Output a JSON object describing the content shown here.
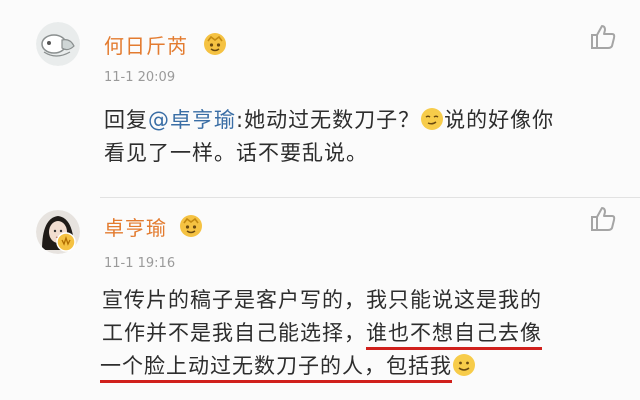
{
  "comments": [
    {
      "username": "何日斤芮",
      "time": "11-1 20:09",
      "text_reply_prefix": "回复",
      "text_mention": "@卓亨瑜",
      "text_part1": ":她动过无数刀子？",
      "text_part2": "说的好像你",
      "text_line2": "看见了一样。话不要乱说。",
      "emoji_icon": "smirk-emoji-icon",
      "badge_icon": "member-badge-icon",
      "like_icon": "thumbs-up-icon"
    },
    {
      "username": "卓亨瑜",
      "time": "11-1 19:16",
      "text_line1": "宣传片的稿子是客户写的，我只能说这是我的",
      "text_line2_a": "工作并不是我自己能选择，",
      "text_line2_b": "谁也不想自己去像",
      "text_line3_a": "一个脸上动过无数刀子的人，包括我",
      "emoji_icon": "smile-emoji-icon",
      "badge_icon": "member-badge-icon",
      "like_icon": "thumbs-up-icon",
      "highlight_color": "#d0201c"
    }
  ],
  "colors": {
    "username": "#e37b2f",
    "mention": "#3a6ea5",
    "time": "#9a9a9a",
    "underline": "#d0201c"
  }
}
